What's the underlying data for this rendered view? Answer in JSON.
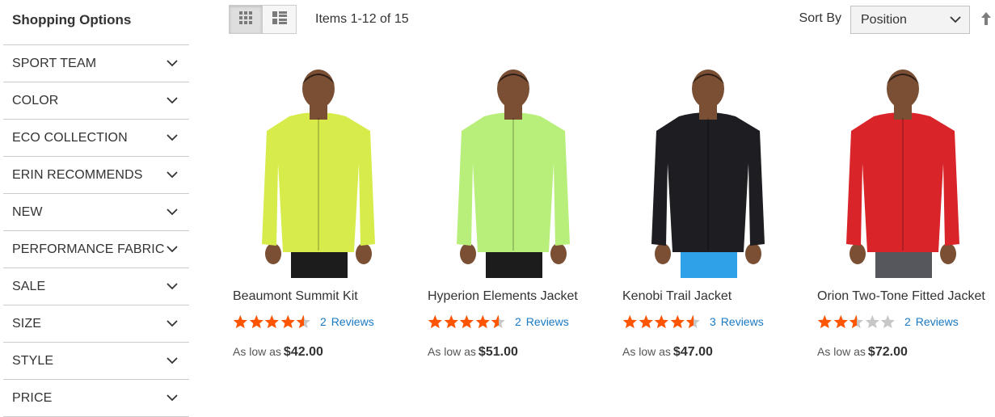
{
  "sidebar": {
    "title": "Shopping Options",
    "filters": [
      {
        "label": "SPORT TEAM"
      },
      {
        "label": "COLOR"
      },
      {
        "label": "ECO COLLECTION"
      },
      {
        "label": "ERIN RECOMMENDS"
      },
      {
        "label": "NEW"
      },
      {
        "label": "PERFORMANCE FABRIC"
      },
      {
        "label": "SALE"
      },
      {
        "label": "SIZE"
      },
      {
        "label": "STYLE"
      },
      {
        "label": "PRICE"
      }
    ]
  },
  "toolbar": {
    "view_modes": [
      {
        "icon": "grid-icon",
        "active": true
      },
      {
        "icon": "list-icon",
        "active": false
      }
    ],
    "items_count": "Items 1-12 of 15",
    "sort_label": "Sort By",
    "sort_value": "Position",
    "sort_direction_icon": "arrow-up-icon"
  },
  "products": [
    {
      "name": "Beaumont Summit Kit",
      "rating": 4.5,
      "reviews_count": "2",
      "reviews_label": "Reviews",
      "price_label": "As low as",
      "price": "$42.00",
      "jacket_color": "#d7ec4a",
      "pants_color": "#1c1c1c"
    },
    {
      "name": "Hyperion Elements Jacket",
      "rating": 4.5,
      "reviews_count": "2",
      "reviews_label": "Reviews",
      "price_label": "As low as",
      "price": "$51.00",
      "jacket_color": "#b8ef7a",
      "pants_color": "#1c1c1c"
    },
    {
      "name": "Kenobi Trail Jacket",
      "rating": 4.5,
      "reviews_count": "3",
      "reviews_label": "Reviews",
      "price_label": "As low as",
      "price": "$47.00",
      "jacket_color": "#1d1d22",
      "pants_color": "#2ea1e8"
    },
    {
      "name": "Orion Two-Tone Fitted Jacket",
      "rating": 2.5,
      "reviews_count": "2",
      "reviews_label": "Reviews",
      "price_label": "As low as",
      "price": "$72.00",
      "jacket_color": "#d9242a",
      "pants_color": "#55575c"
    }
  ],
  "colors": {
    "star_filled": "#ff5501",
    "star_empty": "#c7c7c7",
    "link": "#1979c3",
    "skin": "#7a4f34"
  }
}
